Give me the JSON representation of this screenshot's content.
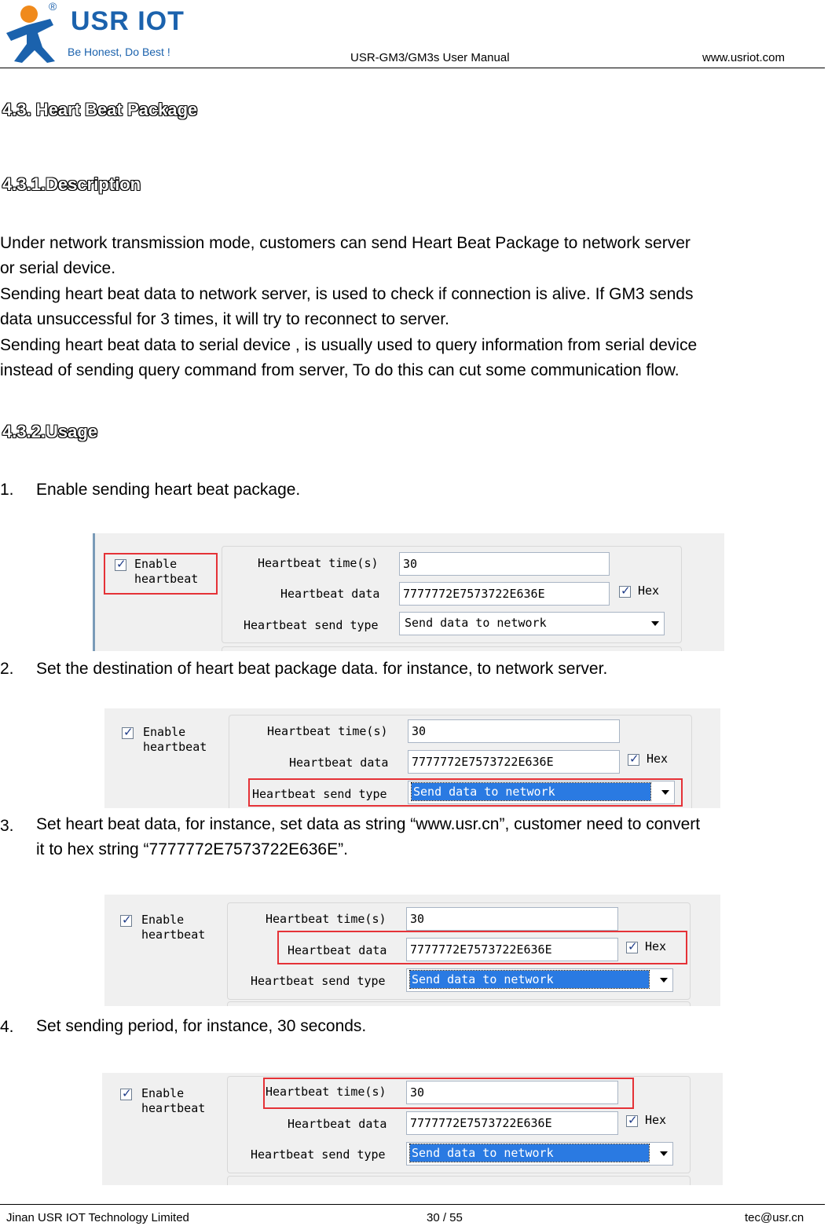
{
  "header": {
    "brand": "USR IOT",
    "slogan": "Be Honest, Do Best !",
    "registered": "®",
    "doc_title": "USR-GM3/GM3s User Manual",
    "website": "www.usriot.com"
  },
  "sections": {
    "s43": "4.3. Heart Beat Package",
    "s431": "4.3.1.Description",
    "s432": "4.3.2.Usage"
  },
  "description": [
    "Under network transmission mode, customers can send Heart Beat Package to network server",
    "or serial device.",
    "Sending heart beat data to network server, is used to check if connection is alive. If GM3 sends",
    "data unsuccessful for 3 times, it will try to reconnect to server.",
    "Sending heart beat data to serial device , is usually used to query information from serial device",
    "instead of sending query command from server, To do this can cut some communication flow."
  ],
  "steps": [
    {
      "num": "1.",
      "lines": [
        "Enable sending heart beat package."
      ]
    },
    {
      "num": "2.",
      "lines": [
        "Set the destination of heart beat package data. for instance, to network server."
      ]
    },
    {
      "num": "3.",
      "lines": [
        "Set heart beat data, for instance, set data as string “www.usr.cn”, customer need to convert",
        "it to hex string “7777772E7573722E636E”."
      ]
    },
    {
      "num": "4.",
      "lines": [
        "Set sending period, for instance, 30 seconds."
      ]
    }
  ],
  "form": {
    "enable_label_1": "Enable",
    "enable_label_2": "heartbeat",
    "time_label": "Heartbeat time(s)",
    "time_value": "30",
    "data_label": "Heartbeat data",
    "data_value": "7777772E7573722E636E",
    "hex_label": "Hex",
    "type_label": "Heartbeat send type",
    "type_value": "Send data to network"
  },
  "footer": {
    "company": "Jinan USR IOT Technology Limited",
    "page": "30 / 55",
    "email": "tec@usr.cn"
  },
  "colors": {
    "brand_blue": "#1b62ad",
    "highlight_red": "#e53237",
    "select_blue": "#2a7ae2"
  }
}
